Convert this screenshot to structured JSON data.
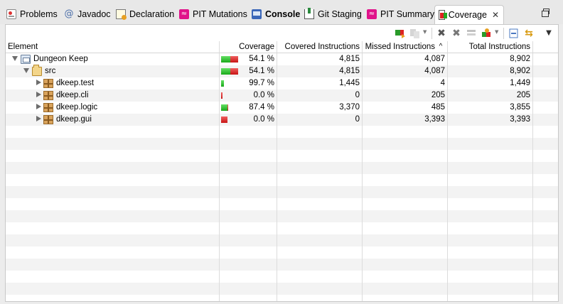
{
  "tabs": [
    {
      "label": "Problems",
      "icon": "problems-icon",
      "active": false
    },
    {
      "label": "Javadoc",
      "icon": "javadoc-icon",
      "active": false
    },
    {
      "label": "Declaration",
      "icon": "declaration-icon",
      "active": false
    },
    {
      "label": "PIT Mutations",
      "icon": "pit-mutations-icon",
      "active": false
    },
    {
      "label": "Console",
      "icon": "console-icon",
      "active": false
    },
    {
      "label": "Git Staging",
      "icon": "git-staging-icon",
      "active": false
    },
    {
      "label": "PIT Summary",
      "icon": "pit-summary-icon",
      "active": false
    },
    {
      "label": "Coverage",
      "icon": "coverage-icon",
      "active": true
    }
  ],
  "toolbar": {
    "glyphs": {
      "relaunch": "",
      "merge": "",
      "remove": "✖",
      "remove_all": "✖",
      "dump": "",
      "sessions": "",
      "collapse": "",
      "link": "⇆",
      "menu": "▼"
    }
  },
  "columns": {
    "element": "Element",
    "coverage": "Coverage",
    "covered": "Covered Instructions",
    "missed": "Missed Instructions",
    "missed_sort_glyph": "^",
    "total": "Total Instructions"
  },
  "rows": [
    {
      "name": "Dungeon Keep",
      "type": "project",
      "level": 0,
      "expanded": true,
      "coverage_pct": 54.1,
      "coverage": "54.1 %",
      "covered": "4,815",
      "missed": "4,087",
      "total": "8,902"
    },
    {
      "name": "src",
      "type": "source-folder",
      "level": 1,
      "expanded": true,
      "coverage_pct": 54.1,
      "coverage": "54.1 %",
      "covered": "4,815",
      "missed": "4,087",
      "total": "8,902"
    },
    {
      "name": "dkeep.test",
      "type": "package",
      "level": 2,
      "expanded": false,
      "coverage_pct": 99.7,
      "coverage": "99.7 %",
      "covered": "1,445",
      "missed": "4",
      "total": "1,449"
    },
    {
      "name": "dkeep.cli",
      "type": "package",
      "level": 2,
      "expanded": false,
      "coverage_pct": 0.0,
      "coverage": "0.0 %",
      "covered": "0",
      "missed": "205",
      "total": "205"
    },
    {
      "name": "dkeep.logic",
      "type": "package",
      "level": 2,
      "expanded": false,
      "coverage_pct": 87.4,
      "coverage": "87.4 %",
      "covered": "3,370",
      "missed": "485",
      "total": "3,855"
    },
    {
      "name": "dkeep.gui",
      "type": "package",
      "level": 2,
      "expanded": false,
      "coverage_pct": 0.0,
      "coverage": "0.0 %",
      "covered": "0",
      "missed": "3,393",
      "total": "3,393"
    }
  ],
  "bar_scale_total": 8902,
  "colors": {
    "covered": "#1aa81a",
    "missed": "#c81414",
    "alt_row": "#f3f3f3",
    "pit_magenta": "#e0128a"
  }
}
